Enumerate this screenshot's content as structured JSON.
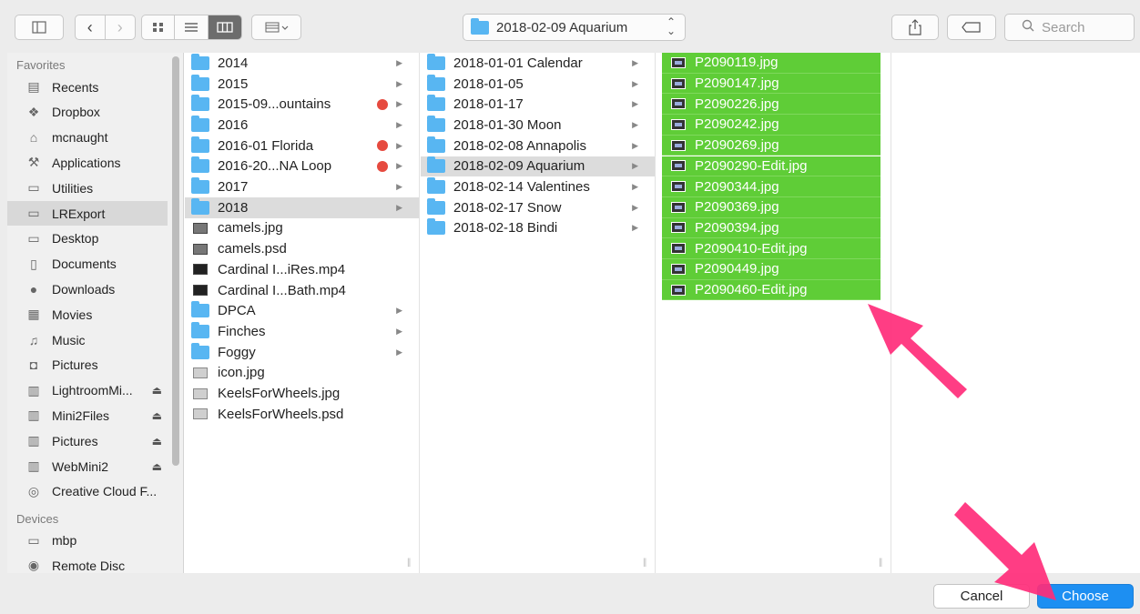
{
  "toolbar": {
    "path_label": "2018-02-09 Aquarium",
    "search_placeholder": "Search"
  },
  "sidebar": {
    "favorites_header": "Favorites",
    "favorites": [
      {
        "label": "Recents",
        "icon": "recents-icon"
      },
      {
        "label": "Dropbox",
        "icon": "dropbox-icon"
      },
      {
        "label": "mcnaught",
        "icon": "home-icon"
      },
      {
        "label": "Applications",
        "icon": "applications-icon"
      },
      {
        "label": "Utilities",
        "icon": "folder-icon"
      },
      {
        "label": "LRExport",
        "icon": "folder-icon",
        "selected": true
      },
      {
        "label": "Desktop",
        "icon": "desktop-icon"
      },
      {
        "label": "Documents",
        "icon": "documents-icon"
      },
      {
        "label": "Downloads",
        "icon": "downloads-icon"
      },
      {
        "label": "Movies",
        "icon": "movies-icon"
      },
      {
        "label": "Music",
        "icon": "music-icon"
      },
      {
        "label": "Pictures",
        "icon": "pictures-icon"
      },
      {
        "label": "LightroomMi...",
        "icon": "drive-icon",
        "eject": true
      },
      {
        "label": "Mini2Files",
        "icon": "drive-icon",
        "eject": true
      },
      {
        "label": "Pictures",
        "icon": "drive-icon",
        "eject": true
      },
      {
        "label": "WebMini2",
        "icon": "drive-icon",
        "eject": true
      },
      {
        "label": "Creative Cloud F...",
        "icon": "creative-cloud-icon"
      }
    ],
    "devices_header": "Devices",
    "devices": [
      {
        "label": "mbp",
        "icon": "laptop-icon"
      },
      {
        "label": "Remote Disc",
        "icon": "disc-icon"
      }
    ]
  },
  "column1": [
    {
      "label": "2014",
      "type": "folder",
      "arrow": true
    },
    {
      "label": "2015",
      "type": "folder",
      "arrow": true
    },
    {
      "label": "2015-09...ountains",
      "type": "folder",
      "arrow": true,
      "tag": "red"
    },
    {
      "label": "2016",
      "type": "folder",
      "arrow": true
    },
    {
      "label": "2016-01 Florida",
      "type": "folder",
      "arrow": true,
      "tag": "red"
    },
    {
      "label": "2016-20...NA Loop",
      "type": "folder",
      "arrow": true,
      "tag": "red"
    },
    {
      "label": "2017",
      "type": "folder",
      "arrow": true
    },
    {
      "label": "2018",
      "type": "folder",
      "arrow": true,
      "selected": true
    },
    {
      "label": "camels.jpg",
      "type": "image"
    },
    {
      "label": "camels.psd",
      "type": "image"
    },
    {
      "label": "Cardinal I...iRes.mp4",
      "type": "video"
    },
    {
      "label": "Cardinal I...Bath.mp4",
      "type": "video"
    },
    {
      "label": "DPCA",
      "type": "folder",
      "arrow": true
    },
    {
      "label": "Finches",
      "type": "folder",
      "arrow": true
    },
    {
      "label": "Foggy",
      "type": "folder",
      "arrow": true
    },
    {
      "label": "icon.jpg",
      "type": "image-light"
    },
    {
      "label": "KeelsForWheels.jpg",
      "type": "image-light"
    },
    {
      "label": "KeelsForWheels.psd",
      "type": "image-light"
    }
  ],
  "column2": [
    {
      "label": "2018-01-01 Calendar",
      "arrow": true
    },
    {
      "label": "2018-01-05",
      "arrow": true
    },
    {
      "label": "2018-01-17",
      "arrow": true
    },
    {
      "label": "2018-01-30 Moon",
      "arrow": true
    },
    {
      "label": "2018-02-08 Annapolis",
      "arrow": true
    },
    {
      "label": "2018-02-09 Aquarium",
      "arrow": true,
      "selected": true
    },
    {
      "label": "2018-02-14 Valentines",
      "arrow": true
    },
    {
      "label": "2018-02-17 Snow",
      "arrow": true
    },
    {
      "label": "2018-02-18 Bindi",
      "arrow": true
    }
  ],
  "column3": [
    "P2090119.jpg",
    "P2090147.jpg",
    "P2090226.jpg",
    "P2090242.jpg",
    "P2090269.jpg",
    "P2090290-Edit.jpg",
    "P2090344.jpg",
    "P2090369.jpg",
    "P2090394.jpg",
    "P2090410-Edit.jpg",
    "P2090449.jpg",
    "P2090460-Edit.jpg"
  ],
  "buttons": {
    "cancel": "Cancel",
    "choose": "Choose"
  },
  "colors": {
    "selection_green": "#5fcd37",
    "choose_blue": "#1d8ff2",
    "folder_blue": "#58b6f2",
    "tag_red": "#e64a3f",
    "annotation_pink": "#ff2d7a"
  }
}
